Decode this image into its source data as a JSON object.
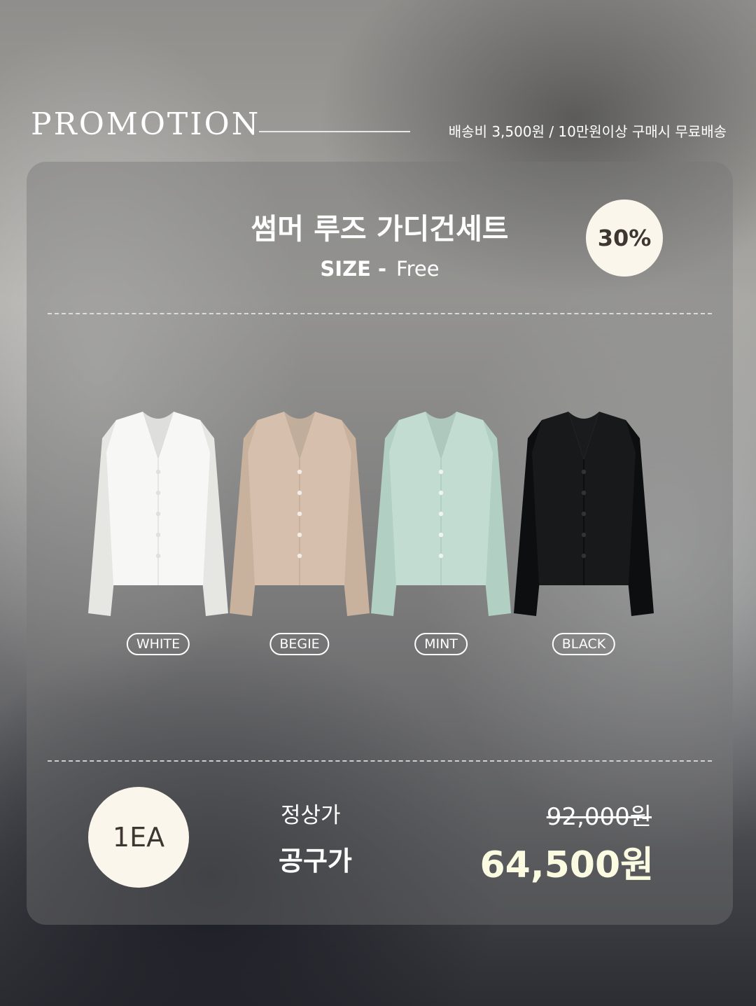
{
  "header": {
    "brand": "PROMOTION",
    "shipping": "배송비 3,500원 / 10만원이상 구매시 무료배송"
  },
  "product": {
    "title": "썸머 루즈 가디건세트",
    "size_label": "SIZE -",
    "size_value": "Free",
    "discount": "30%"
  },
  "colors": [
    {
      "label": "WHITE",
      "body": "#f7f7f5",
      "shade": "#e6e6e3",
      "button": "#e0e0dc"
    },
    {
      "label": "BEGIE",
      "body": "#d6c0ad",
      "shade": "#c8b19d",
      "button": "#f2ede6"
    },
    {
      "label": "MINT",
      "body": "#c3dcd1",
      "shade": "#b2cfc3",
      "button": "#eef4f1"
    },
    {
      "label": "BLACK",
      "body": "#17191a",
      "shade": "#0d0e0f",
      "button": "#333"
    }
  ],
  "pricing": {
    "quantity": "1EA",
    "regular_label": "정상가",
    "regular_price": "92,000원",
    "sale_label": "공구가",
    "sale_price": "64,500원"
  }
}
